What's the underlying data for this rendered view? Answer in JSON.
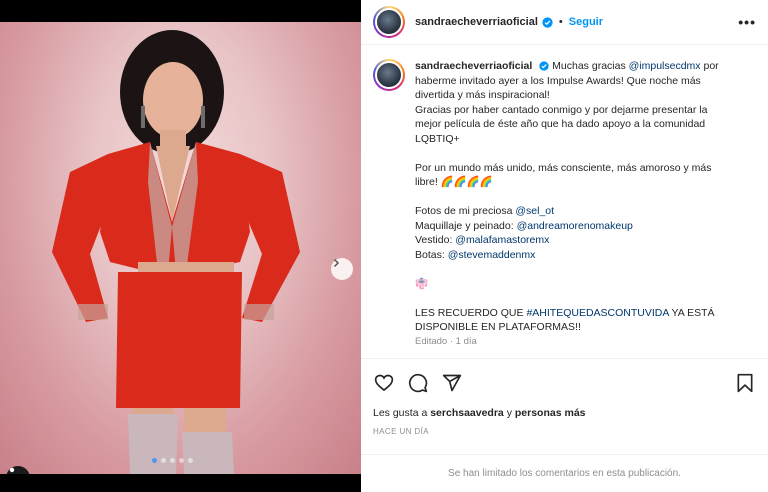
{
  "post": {
    "username": "sandraecheverriaoficial",
    "follow_label": "Seguir",
    "more_label": "•••",
    "caption": {
      "username": "sandraecheverriaoficial",
      "line1_pre": "Muchas gracias ",
      "mention_impulse": "@impulsecdmx",
      "line1_post": " por haberme invitado ayer a los Impulse Awards! Que noche más divertida y más inspiracional!",
      "line2": "Gracias por haber cantado conmigo y por dejarme presentar la mejor película de éste año que ha dado apoyo a la comunidad LQBTIQ+",
      "line3": "Por un mundo más unido, más consciente, más amoroso y más libre! 🌈🌈🌈🌈",
      "photos_label": "Fotos de mi preciosa ",
      "photos_mention": "@sel_ot",
      "makeup_label": "Maquillaje y peinado: ",
      "makeup_mention": "@andreamorenomakeup",
      "dress_label": "Vestido: ",
      "dress_mention": "@malafamastoremx",
      "boots_label": "Botas: ",
      "boots_mention": "@stevemaddenmx",
      "emoji_line": "👘",
      "recuerdo_pre": "LES RECUERDO QUE ",
      "recuerdo_tag": "#AHITEQUEDASCONTUVIDA",
      "recuerdo_post": " YA ESTÁ DISPONIBLE EN PLATAFORMAS!!",
      "edited": "Editado · 1 día"
    },
    "likes_pre": "Les gusta a ",
    "likes_user": "serchsaavedra",
    "likes_mid": " y ",
    "likes_more": "personas más",
    "time": "HACE UN DÍA",
    "comments_limited": "Se han limitado los comentarios en esta publicación.",
    "carousel": {
      "slides": 5,
      "current": 1
    }
  },
  "icons": [
    "heart-icon",
    "comment-icon",
    "share-icon",
    "bookmark-icon",
    "chevron-right-icon",
    "user-tag-icon",
    "verified-icon"
  ],
  "colors": {
    "link": "#0095f6",
    "mention": "#00376b",
    "muted": "#8e8e8e",
    "dress": "#d92a1c"
  }
}
